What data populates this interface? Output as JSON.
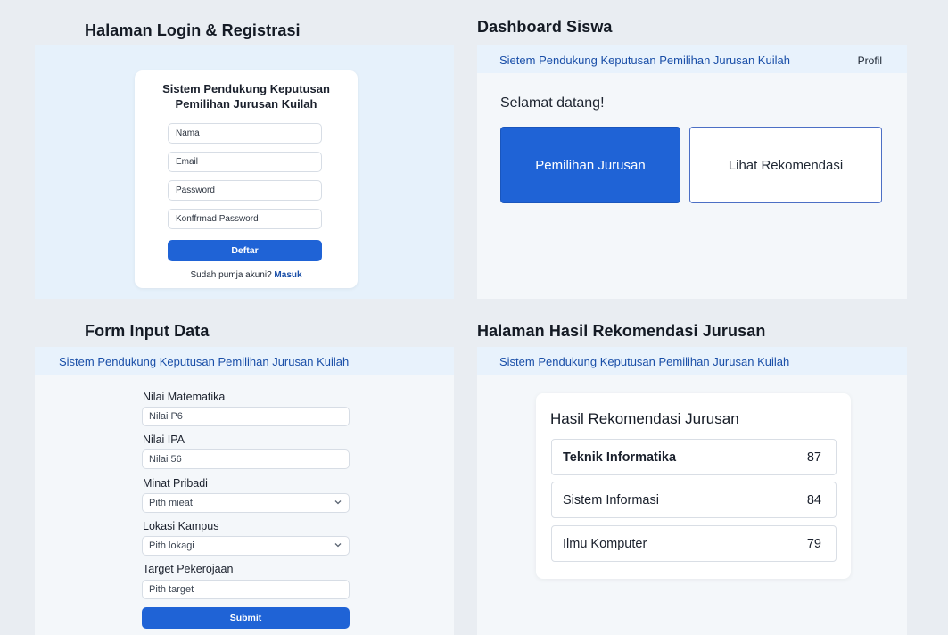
{
  "app_name": "Sistem Pendukung Keputusan Pemilihan Jurusan Kuilah",
  "colors": {
    "primary": "#1f63d6",
    "link": "#1a4fa8",
    "header_bg": "#e8f2fc"
  },
  "login_section": {
    "title": "Halaman Login & Registrasi",
    "card_title_line1": "Sistem Pendukung Keputusan",
    "card_title_line2": "Pemilihan Jurusan Kuilah",
    "name_value": "Nama",
    "email_value": "Email",
    "password_value": "Password",
    "confirm_value": "Konffrmad Password",
    "register_button": "Deftar",
    "footer_text": "Sudah pumja akuni?",
    "login_link": "Masuk"
  },
  "dashboard_section": {
    "title": "Dashboard Siswa",
    "header_title": "Sietem Pendukung Keputusan Pemilihan Jurusan Kuilah",
    "profile_link": "Profil",
    "welcome": "Selamat datang!",
    "primary_button": "Pemilihan Jurusan",
    "secondary_button": "Lihat Rekomendasi"
  },
  "form_section": {
    "title": "Form Input Data",
    "header_title": "Sistem Pendukung Keputusan Pemilihan Jurusan Kuilah",
    "fields": [
      {
        "label": "Nilai Matematika",
        "value": "Nilai P6"
      },
      {
        "label": "Nilai IPA",
        "value": "Nilai 56"
      },
      {
        "label": "Minat Pribadi",
        "value": "Pith mieat",
        "icon": "chevron-down-icon"
      },
      {
        "label": "Lokasi Kampus",
        "value": "Pith lokagi",
        "icon": "chevron-down-icon"
      },
      {
        "label": "Target Pekerojaan",
        "value": "Pith target"
      }
    ],
    "submit_button": "Submit"
  },
  "results_section": {
    "title": "Halaman Hasil Rekomendasi Jurusan",
    "header_title": "Sistem Pendukung Keputusan Pemilihan Jurusan Kuilah",
    "card_title": "Hasil Rekomendasi Jurusan",
    "results": [
      {
        "name": "Teknik Informatika",
        "score": "87"
      },
      {
        "name": "Sistem Informasi",
        "score": "84"
      },
      {
        "name": "Ilmu Komputer",
        "score": "79"
      }
    ]
  }
}
